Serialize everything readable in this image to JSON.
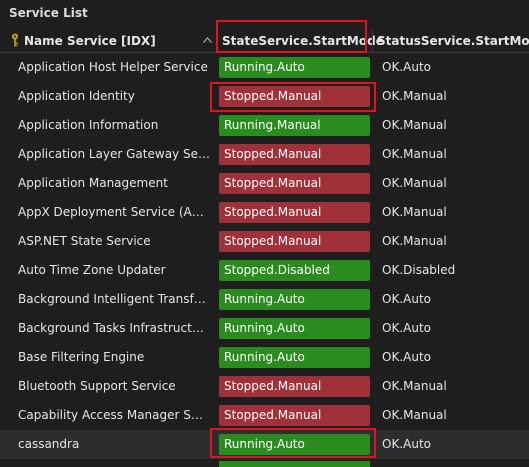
{
  "panel": {
    "title": "Service List"
  },
  "columns": {
    "name": "Name Service [IDX]",
    "state": "StateService.StartMode",
    "status": "StatusService.StartMode"
  },
  "icons": {
    "key": "key-icon",
    "sort": "sort-ascending-icon"
  },
  "colors": {
    "running": "#2a8b1e",
    "stopped": "#a0313a",
    "highlight": "#e0141e"
  },
  "rows": [
    {
      "name": "Application Host Helper Service",
      "state": "Running.Auto",
      "status": "OK.Auto",
      "kind": "running"
    },
    {
      "name": "Application Identity",
      "state": "Stopped.Manual",
      "status": "OK.Manual",
      "kind": "stopped"
    },
    {
      "name": "Application Information",
      "state": "Running.Manual",
      "status": "OK.Manual",
      "kind": "running"
    },
    {
      "name": "Application Layer Gateway Service",
      "state": "Stopped.Manual",
      "status": "OK.Manual",
      "kind": "stopped"
    },
    {
      "name": "Application Management",
      "state": "Stopped.Manual",
      "status": "OK.Manual",
      "kind": "stopped"
    },
    {
      "name": "AppX Deployment Service (AppXS...",
      "state": "Stopped.Manual",
      "status": "OK.Manual",
      "kind": "stopped"
    },
    {
      "name": "ASP.NET State Service",
      "state": "Stopped.Manual",
      "status": "OK.Manual",
      "kind": "stopped"
    },
    {
      "name": "Auto Time Zone Updater",
      "state": "Stopped.Disabled",
      "status": "OK.Disabled",
      "kind": "disabled"
    },
    {
      "name": "Background Intelligent Transfer Se...",
      "state": "Running.Auto",
      "status": "OK.Auto",
      "kind": "running"
    },
    {
      "name": "Background Tasks Infrastructure S...",
      "state": "Running.Auto",
      "status": "OK.Auto",
      "kind": "running"
    },
    {
      "name": "Base Filtering Engine",
      "state": "Running.Auto",
      "status": "OK.Auto",
      "kind": "running"
    },
    {
      "name": "Bluetooth Support Service",
      "state": "Stopped.Manual",
      "status": "OK.Manual",
      "kind": "stopped"
    },
    {
      "name": "Capability Access Manager Service",
      "state": "Stopped.Manual",
      "status": "OK.Manual",
      "kind": "stopped"
    },
    {
      "name": "cassandra",
      "state": "Running.Auto",
      "status": "OK.Auto",
      "kind": "running",
      "selected": true
    }
  ]
}
